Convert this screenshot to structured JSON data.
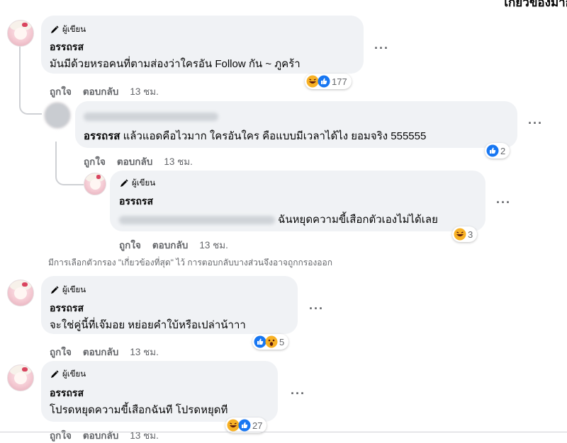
{
  "filter_label": "เกี่ยวข้องมาก",
  "author_badge": "ผู้เขียน",
  "notice": "มีการเลือกตัวกรอง \"เกี่ยวข้องที่สุด\" ไว้ การตอบกลับบางส่วนจึงอาจถูกกรองออก",
  "comments": [
    {
      "name": "อรรถรส",
      "text": "มันมีด้วยหรอคนที่ตามส่องว่าใครอัน Follow กัน ~ ภูคร้า",
      "like": "ถูกใจ",
      "reply": "ตอบกลับ",
      "time": "13 ชม.",
      "reactions": [
        "haha",
        "like"
      ],
      "count": "177"
    },
    {
      "name": "อรรถรส",
      "text": "แล้วแอดคือไวมาก ใครอันใคร คือแบบมีเวลาได้ไง ยอมจริง 555555",
      "like": "ถูกใจ",
      "reply": "ตอบกลับ",
      "time": "13 ชม.",
      "reactions": [
        "like"
      ],
      "count": "2"
    },
    {
      "name": "อรรถรส",
      "text": "ฉันหยุดความขี้เสือกตัวเองไม่ได้เลย",
      "like": "ถูกใจ",
      "reply": "ตอบกลับ",
      "time": "13 ชม.",
      "reactions": [
        "haha"
      ],
      "count": "3"
    },
    {
      "name": "อรรถรส",
      "text": "จะใช่คู่นี้ที่เจ๊มอย หย่อยคำใบ้หรือเปล่าน้าาา",
      "like": "ถูกใจ",
      "reply": "ตอบกลับ",
      "time": "13 ชม.",
      "reactions": [
        "like",
        "wow"
      ],
      "count": "5"
    },
    {
      "name": "อรรถรส",
      "text": "โปรดหยุดความขี้เสือกฉันที โปรดหยุดที",
      "like": "ถูกใจ",
      "reply": "ตอบกลับ",
      "time": "13 ชม.",
      "reactions": [
        "haha",
        "like"
      ],
      "count": "27"
    }
  ],
  "colors": {
    "like_blue": "#1877f2",
    "haha_yellow": "#f7b125",
    "muted": "#65676b",
    "bubble": "#f0f2f5"
  }
}
